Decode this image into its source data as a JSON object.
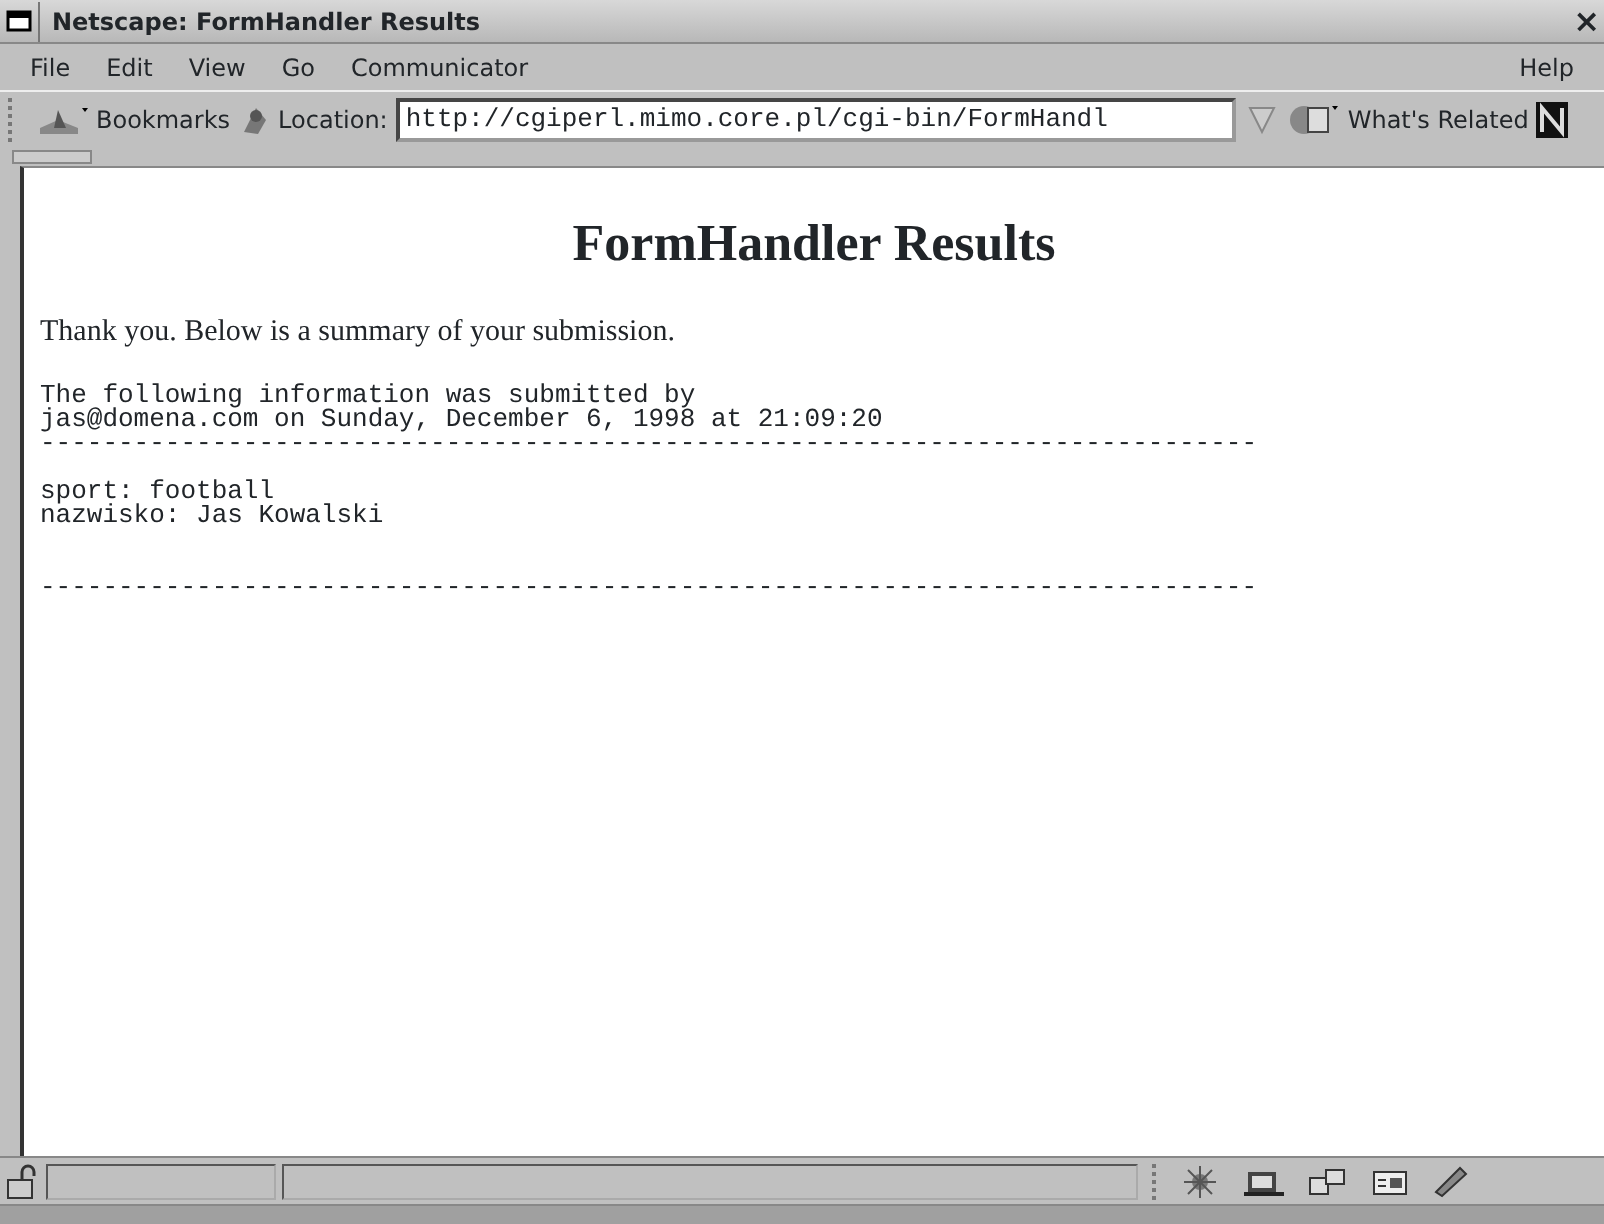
{
  "window": {
    "title": "Netscape: FormHandler Results",
    "close": "×"
  },
  "menu": [
    "File",
    "Edit",
    "View",
    "Go",
    "Communicator"
  ],
  "menu_right": "Help",
  "toolbar": {
    "bookmarks": "Bookmarks",
    "location_label": "Location:",
    "url": "http://cgiperl.mimo.core.pl/cgi-bin/FormHandl",
    "related": "What's Related"
  },
  "page": {
    "heading": "FormHandler Results",
    "intro": "Thank you. Below is a summary of your submission.",
    "pre_blocks": [
      {
        "kind": "text",
        "lines": [
          "The following information was submitted by",
          "jas@domena.com on Sunday, December 6, 1998 at 21:09:20"
        ]
      },
      {
        "kind": "rule",
        "text": "------------------------------------------------------------------------------"
      },
      {
        "kind": "text",
        "lines": [
          "sport: football",
          "nazwisko: Jas Kowalski"
        ]
      },
      {
        "kind": "rule",
        "text": "------------------------------------------------------------------------------"
      }
    ]
  },
  "status_bar": {
    "secure": false
  }
}
